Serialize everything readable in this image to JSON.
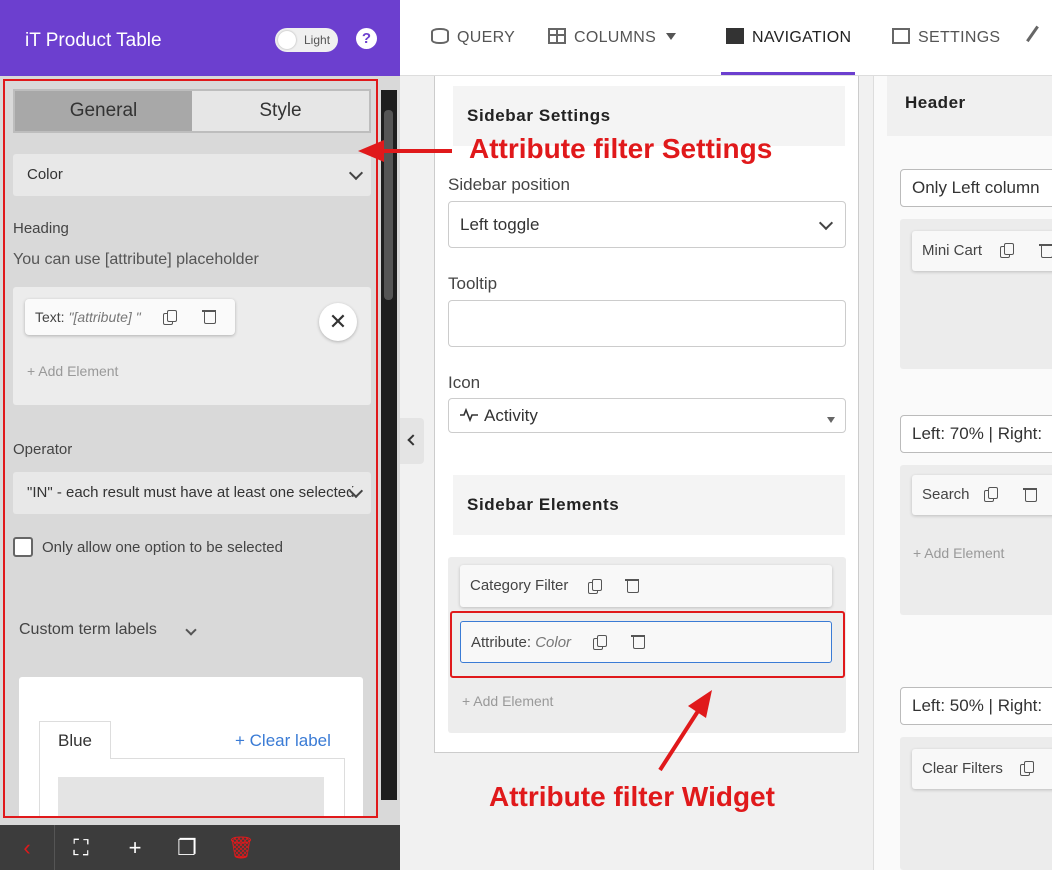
{
  "brand": {
    "title": "iT Product Table",
    "toggle_label": "Light",
    "help": "?"
  },
  "left": {
    "tabs": [
      "General",
      "Style"
    ],
    "attribute_select": "Color",
    "heading_label": "Heading",
    "heading_hint": "You can use [attribute] placeholder",
    "text_chip_prefix": "Text: ",
    "text_chip_value": "\"[attribute] \"",
    "close": "✕",
    "add_element": "+ Add Element",
    "operator_label": "Operator",
    "operator_value": "\"IN\" - each result must have at least one selected",
    "checkbox_label": "Only allow one option to be selected",
    "custom_terms_label": "Custom term labels",
    "term_tab": "Blue",
    "clear_label": "+ Clear label"
  },
  "bottom_bar": {
    "back": "‹",
    "fullscreen": "⛶",
    "add": "+",
    "copy": "❐",
    "delete": "🗑"
  },
  "nav": {
    "items": [
      "QUERY",
      "COLUMNS",
      "NAVIGATION",
      "SETTINGS"
    ],
    "active": "NAVIGATION"
  },
  "center": {
    "sidebar_settings_title": "Sidebar Settings",
    "sidebar_position_label": "Sidebar position",
    "sidebar_position_value": "Left toggle",
    "tooltip_label": "Tooltip",
    "tooltip_value": "",
    "icon_label": "Icon",
    "icon_value": "Activity",
    "sidebar_elements_title": "Sidebar Elements",
    "elements": [
      {
        "prefix": "Category Filter",
        "value": ""
      },
      {
        "prefix": "Attribute: ",
        "value": "Color"
      }
    ],
    "add_element": "+ Add Element"
  },
  "right": {
    "header_title": "Header",
    "rows": [
      {
        "layout": "Only Left column",
        "chip": "Mini Cart"
      },
      {
        "layout": "Left: 70% | Right:",
        "chip": "Search",
        "add": "+ Add Element"
      },
      {
        "layout": "Left: 50% | Right:",
        "chip": "Clear Filters"
      }
    ]
  },
  "annotations": {
    "settings": "Attribute filter Settings",
    "widget": "Attribute filter Widget"
  },
  "colors": {
    "brand": "#6c3fcf",
    "annotation": "#e0191b",
    "link": "#3a7bd5"
  }
}
